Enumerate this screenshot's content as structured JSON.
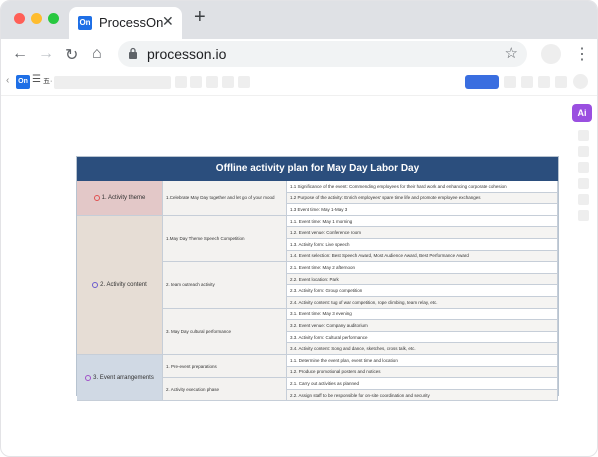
{
  "browser": {
    "tab_title": "ProcessOn",
    "tab_logo": "On",
    "url": "processon.io",
    "new_tab_glyph": "+",
    "close_glyph": "✕"
  },
  "app": {
    "logo": "On",
    "doc_name": "五·"
  },
  "ai_label": "Ai",
  "table": {
    "title": "Offline activity plan for May Day Labor Day",
    "sections": [
      {
        "label": "1. Activity theme",
        "marker_color": "#e05050",
        "bg": "#e3c8c8",
        "groups": [
          {
            "label": "1.Celebrate May Day together and let go of your mood",
            "items": [
              "1.1 Significance of the event: Commending employees for their hard work and enhancing corporate cohesion",
              "1.2 Purpose of the activity: Enrich employees' spare time life and promote employee exchanges",
              "1.3 Event time: May 1-May 3"
            ]
          }
        ]
      },
      {
        "label": "2. Activity content",
        "marker_color": "#6a5acd",
        "bg": "#e6ddd5",
        "groups": [
          {
            "label": "1.May Day Theme Speech Competition",
            "items": [
              "1.1. Event time: May 1 morning",
              "1.2. Event venue: Conference room",
              "1.3. Activity form: Live speech",
              "1.4. Event selection: Best Speech Award, Most Audience Award, Best Performance Award"
            ]
          },
          {
            "label": "2. team outreach activity",
            "items": [
              "2.1. Event time: May 2 afternoon",
              "2.2. Event location: Park",
              "2.3. Activity form: Group competition",
              "2.4. Activity content: tug of war competition, rope climbing, team relay, etc."
            ]
          },
          {
            "label": "3. May Day cultural performance",
            "items": [
              "3.1. Event time: May 3 evening",
              "3.2. Event venue: Company auditorium",
              "3.3. Activity form: Cultural performance",
              "3.4. Activity content: Song and dance, sketches, cross talk, etc."
            ]
          }
        ]
      },
      {
        "label": "3. Event arrangements",
        "marker_color": "#a050c8",
        "bg": "#d0d9e4",
        "groups": [
          {
            "label": "1. Pre-event preparations",
            "items": [
              "1.1. Determine the event plan, event time and location",
              "1.2. Produce promotional posters and notices"
            ]
          },
          {
            "label": "2. Activity execution phase",
            "items": [
              "2.1. Carry out activities as planned",
              "2.2. Assign staff to be responsible for on-site coordination and security"
            ]
          }
        ]
      }
    ]
  }
}
